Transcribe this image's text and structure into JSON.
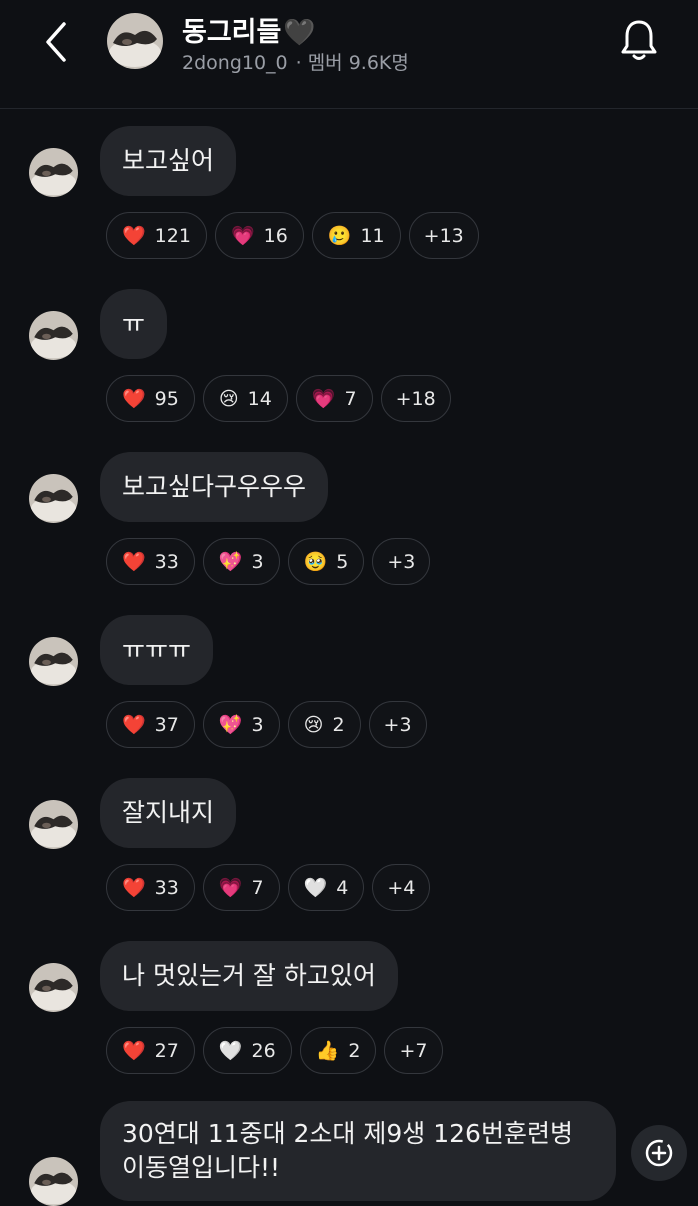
{
  "header": {
    "title": "동그리들",
    "title_emoji": "🖤",
    "handle": "2dong10_0",
    "separator": "·",
    "members": "멤버 9.6K명"
  },
  "messages": [
    {
      "text": "보고싶어",
      "reactions": [
        {
          "emoji": "❤️",
          "icon": "red-heart-icon",
          "count": "121"
        },
        {
          "emoji": "💗",
          "icon": "pink-heart-icon",
          "count": "16"
        },
        {
          "emoji": "🥲",
          "icon": "tear-smile-icon",
          "count": "11"
        }
      ],
      "more": "+13"
    },
    {
      "text": "ㅠ",
      "reactions": [
        {
          "emoji": "❤️",
          "icon": "red-heart-icon",
          "count": "95"
        },
        {
          "emoji": "😢",
          "icon": "crying-face-icon",
          "count": "14"
        },
        {
          "emoji": "💗",
          "icon": "pink-heart-icon",
          "count": "7"
        }
      ],
      "more": "+18"
    },
    {
      "text": "보고싶다구우우우",
      "reactions": [
        {
          "emoji": "❤️",
          "icon": "red-heart-icon",
          "count": "33"
        },
        {
          "emoji": "💖",
          "icon": "sparkling-heart-icon",
          "count": "3"
        },
        {
          "emoji": "🥹",
          "icon": "holding-tears-icon",
          "count": "5"
        }
      ],
      "more": "+3"
    },
    {
      "text": "ㅠㅠㅠ",
      "reactions": [
        {
          "emoji": "❤️",
          "icon": "red-heart-icon",
          "count": "37"
        },
        {
          "emoji": "💖",
          "icon": "sparkling-heart-icon",
          "count": "3"
        },
        {
          "emoji": "😢",
          "icon": "crying-face-icon",
          "count": "2"
        }
      ],
      "more": "+3"
    },
    {
      "text": "잘지내지",
      "reactions": [
        {
          "emoji": "❤️",
          "icon": "red-heart-icon",
          "count": "33"
        },
        {
          "emoji": "💗",
          "icon": "pink-heart-icon",
          "count": "7"
        },
        {
          "emoji": "🤍",
          "icon": "white-heart-icon",
          "count": "4"
        }
      ],
      "more": "+4"
    },
    {
      "text": "나 멋있는거 잘 하고있어",
      "reactions": [
        {
          "emoji": "❤️",
          "icon": "red-heart-icon",
          "count": "27"
        },
        {
          "emoji": "🤍",
          "icon": "white-heart-icon",
          "count": "26"
        },
        {
          "emoji": "👍",
          "icon": "thumbs-up-icon",
          "count": "2"
        }
      ],
      "more": "+7"
    }
  ],
  "last_message": {
    "line1": "30연대 11중대 2소대 제9생 126번훈련병",
    "line2": "이동열입니다!!"
  },
  "colors": {
    "background": "#0e1014",
    "bubble": "#24262b",
    "chip_border": "#34373d",
    "muted_text": "#9a9ea6"
  }
}
